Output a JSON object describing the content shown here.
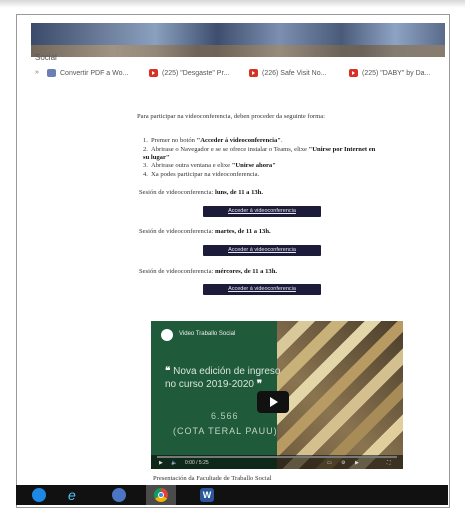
{
  "browser": {
    "breadcrumb": "Social",
    "tabs": [
      {
        "label": "Convertir PDF a Wo...",
        "icon": "document-icon"
      },
      {
        "label": "(225) \"Desgaste\" Pr...",
        "icon": "youtube-icon"
      },
      {
        "label": "(226) Safe Visit No...",
        "icon": "youtube-icon"
      },
      {
        "label": "(225) \"DABY\" by Da...",
        "icon": "youtube-icon"
      }
    ]
  },
  "page": {
    "intro": "Para participar na videoconferencia, deben proceder da seguinte forma:",
    "steps": [
      {
        "num": "1.",
        "text": "Premer no botón ",
        "bold": "\"Acceder á videoconferencia\"",
        "after": "."
      },
      {
        "num": "2.",
        "text": "Abrirase o Navegador e se se ofrece instalar o Teams, elixe ",
        "bold": "\"Unirse por Internet en su lugar\"",
        "after": ""
      },
      {
        "num": "3.",
        "text": "Abrirase outra ventana e elixe ",
        "bold": "\"Unirse ahora\"",
        "after": ""
      },
      {
        "num": "4.",
        "text": "Xa podes participar na videoconferencia.",
        "bold": "",
        "after": ""
      }
    ],
    "sessions": [
      {
        "prefix": "Sesión de videoconferencia: ",
        "day": "luns, de 11 a 13h.",
        "button": "Acceder á videoconferencia"
      },
      {
        "prefix": "Sesión de videoconferencia: ",
        "day": "martes, de 11 a 13h.",
        "button": "Acceder á videoconferencia"
      },
      {
        "prefix": "Sesión de videoconferencia: ",
        "day": "mércores, de 11 a 13h.",
        "button": "Acceder á videoconferencia"
      }
    ],
    "video": {
      "channel": "Video Traballo Social",
      "headline_line1": "Nova edición de ingreso",
      "headline_line2": "no curso 2019-2020",
      "value": "6.566",
      "cota": "(COTA TERAL PAUU)",
      "time": "0:00 / 5:25",
      "progress_fraction": 0.0
    },
    "caption": "Presentación da Facultade de Traballo Social"
  },
  "taskbar": {
    "word_label": "W"
  }
}
